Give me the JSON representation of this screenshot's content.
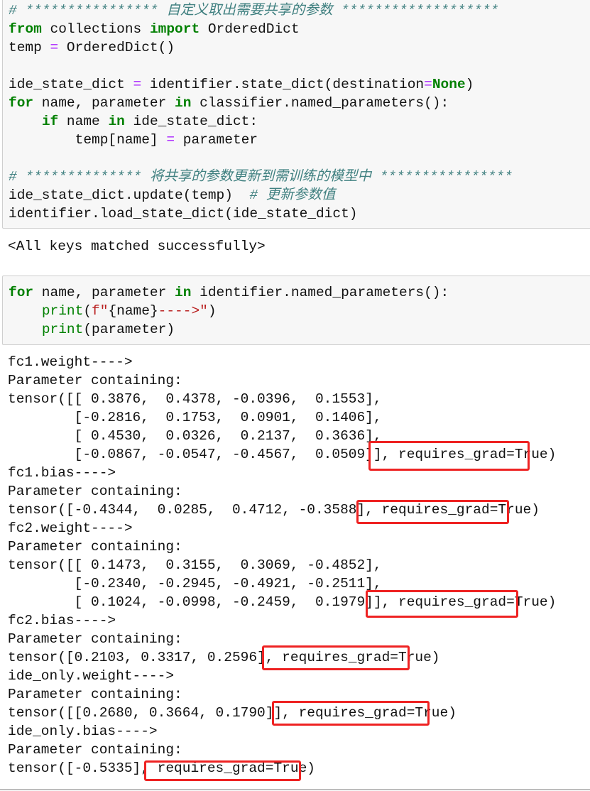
{
  "notebook": {
    "cells": [
      {
        "type": "code",
        "lines": [
          "# **************** 自定义取出需要共享的参数 *******************",
          "from collections import OrderedDict",
          "temp = OrderedDict()",
          "",
          "ide_state_dict = identifier.state_dict(destination=None)",
          "for name, parameter in classifier.named_parameters():",
          "    if name in ide_state_dict:",
          "        temp[name] = parameter",
          "",
          "# ************** 将共享的参数更新到需训练的模型中 ****************",
          "ide_state_dict.update(temp)  # 更新参数值",
          "identifier.load_state_dict(ide_state_dict)"
        ],
        "output": "<All keys matched successfully>"
      },
      {
        "type": "code",
        "lines": [
          "for name, parameter in identifier.named_parameters():",
          "    print(f\"{name}---->\")",
          "    print(parameter)"
        ],
        "output_lines": [
          "fc1.weight---->",
          "Parameter containing:",
          "tensor([[ 0.3876,  0.4378, -0.0396,  0.1553],",
          "        [-0.2816,  0.1753,  0.0901,  0.1406],",
          "        [ 0.4530,  0.0326,  0.2137,  0.3636],",
          "        [-0.0867, -0.0547, -0.4567,  0.0509]], requires_grad=True)",
          "fc1.bias---->",
          "Parameter containing:",
          "tensor([-0.4344,  0.0285,  0.4712, -0.3588], requires_grad=True)",
          "fc2.weight---->",
          "Parameter containing:",
          "tensor([[ 0.1473,  0.3155,  0.3069, -0.4852],",
          "        [-0.2340, -0.2945, -0.4921, -0.2511],",
          "        [ 0.1024, -0.0998, -0.2459,  0.1979]], requires_grad=True)",
          "fc2.bias---->",
          "Parameter containing:",
          "tensor([0.2103, 0.3317, 0.2596], requires_grad=True)",
          "ide_only.weight---->",
          "Parameter containing:",
          "tensor([[0.2680, 0.3664, 0.1790]], requires_grad=True)",
          "ide_only.bias---->",
          "Parameter containing:",
          "tensor([-0.5335], requires_grad=True)"
        ]
      }
    ],
    "highlights": {
      "label": "requires_grad=True",
      "color": "#ee2222",
      "count": 6
    }
  },
  "colors": {
    "keyword": "#008000",
    "operator": "#aa22ff",
    "comment": "#408080",
    "string": "#ba2121",
    "cell_bg": "#f7f7f7",
    "cell_border": "#cfcfcf"
  }
}
